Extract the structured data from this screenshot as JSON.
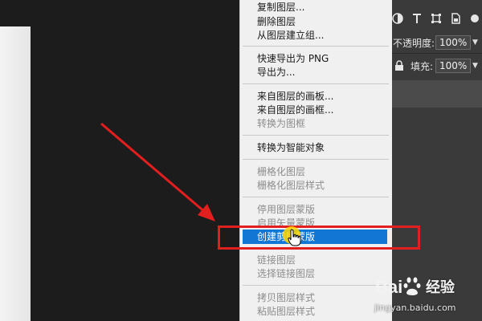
{
  "context_menu": {
    "items": [
      {
        "label": "复制图层...",
        "enabled": true
      },
      {
        "label": "删除图层",
        "enabled": true
      },
      {
        "label": "从图层建立组...",
        "enabled": true
      },
      {
        "label": "快速导出为 PNG",
        "enabled": true
      },
      {
        "label": "导出为...",
        "enabled": true
      },
      {
        "label": "来自图层的画板...",
        "enabled": true
      },
      {
        "label": "来自图层的画框...",
        "enabled": true
      },
      {
        "label": "转换为图框",
        "enabled": false
      },
      {
        "label": "转换为智能对象",
        "enabled": true
      },
      {
        "label": "栅格化图层",
        "enabled": false
      },
      {
        "label": "栅格化图层样式",
        "enabled": false
      },
      {
        "label": "停用图层蒙版",
        "enabled": false
      },
      {
        "label": "启用矢量蒙版",
        "enabled": false
      },
      {
        "label": "创建剪贴蒙版",
        "enabled": true,
        "highlighted": true
      },
      {
        "label": "链接图层",
        "enabled": false
      },
      {
        "label": "选择链接图层",
        "enabled": false
      },
      {
        "label": "拷贝图层样式",
        "enabled": false
      },
      {
        "label": "粘贴图层样式",
        "enabled": false
      }
    ]
  },
  "layers_panel": {
    "opacity_label": "不透明度:",
    "opacity_value": "100%",
    "fill_label": "填充:",
    "fill_value": "100%",
    "filter_icons": [
      "adjustment-layer-icon",
      "type-layer-icon",
      "shape-layer-icon",
      "smart-object-icon"
    ]
  },
  "watermark": {
    "logo_text": "Bai",
    "brand_text": "经验",
    "url": "jingyan.baidu.com"
  },
  "colors": {
    "highlight": "#1277d4",
    "annotation_red": "#e21e1e",
    "cursor_dot": "#ffd600"
  }
}
